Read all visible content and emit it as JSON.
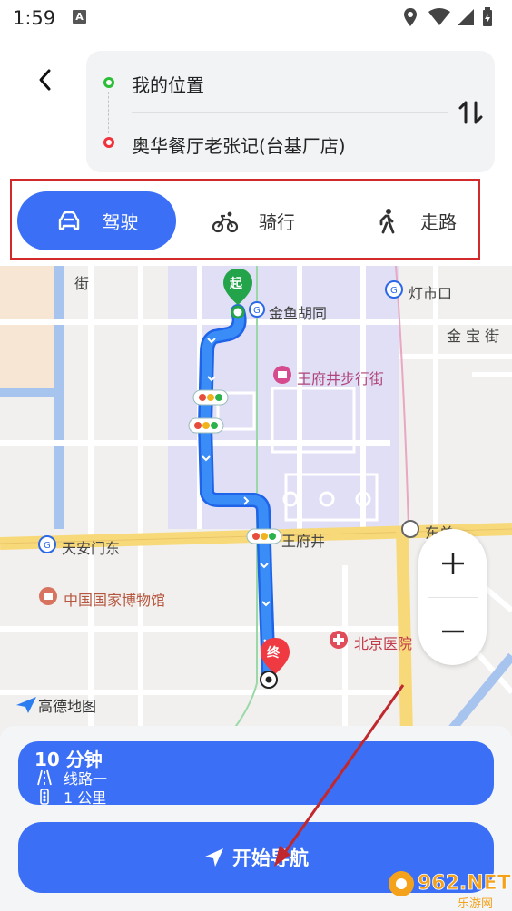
{
  "status_bar": {
    "time": "1:59",
    "notification_letter": "A"
  },
  "route": {
    "origin": "我的位置",
    "destination": "奥华餐厅老张记(台基厂店)"
  },
  "modes": [
    {
      "label": "驾驶",
      "icon": "car-icon",
      "active": true
    },
    {
      "label": "骑行",
      "icon": "bike-icon",
      "active": false
    },
    {
      "label": "走路",
      "icon": "walk-icon",
      "active": false
    }
  ],
  "map": {
    "labels": {
      "street_jie": "街",
      "jinyu_hutong": "金鱼胡同",
      "dengshikou": "灯市口",
      "jinbao_jie": "金 宝 街",
      "wangfujing_walk": "王府井步行街",
      "wangfujing": "王府井",
      "tiananmen_east": "天安门东",
      "dongdan": "东单",
      "museum": "中国国家博物馆",
      "hospital": "北京医院"
    },
    "start_marker": "起",
    "end_marker": "终",
    "provider": "高德地图",
    "colors": {
      "route": "#2f7cf6",
      "building": "#e0dff5",
      "road_major": "#f8d97a"
    }
  },
  "route_info": {
    "duration": "10 分钟",
    "road": "线路一",
    "traffic": "1 公里"
  },
  "start_button": {
    "label": "开始导航"
  },
  "watermark": {
    "brand": "962.NET",
    "subtitle": "乐游网"
  },
  "colors": {
    "accent": "#3b6ff6",
    "highlight_border": "#d22a2a"
  }
}
